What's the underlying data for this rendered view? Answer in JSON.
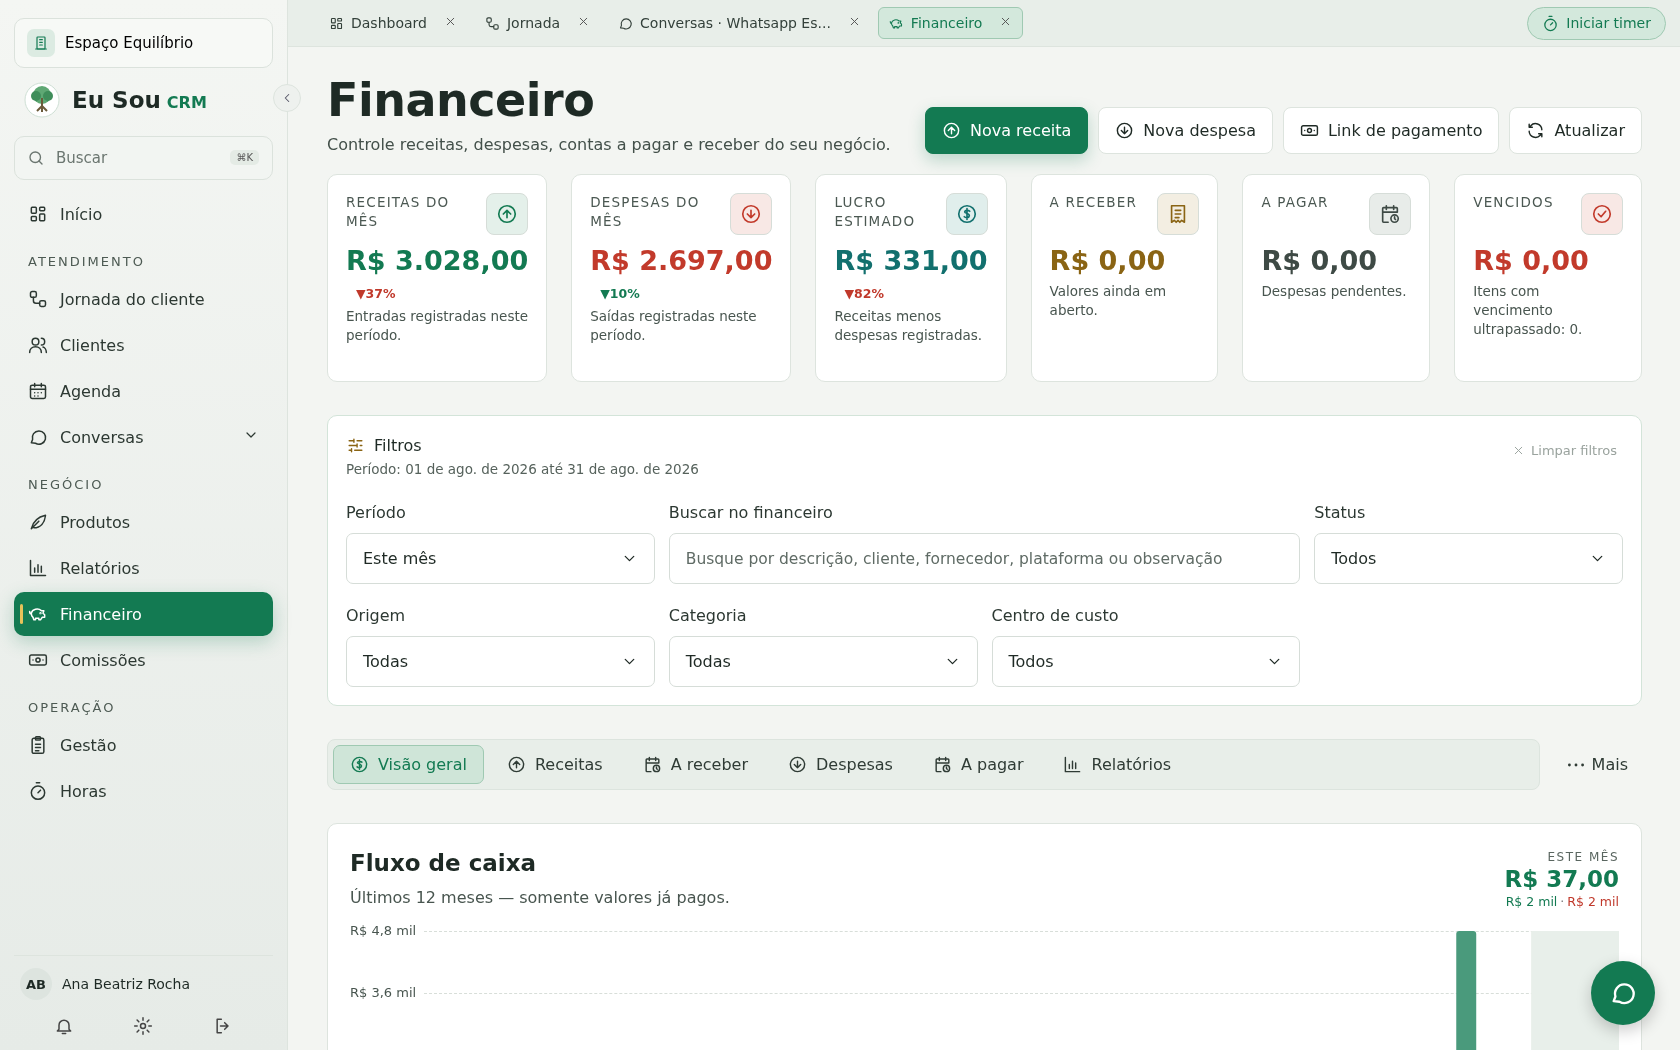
{
  "workspace": {
    "name": "Espaço Equilíbrio"
  },
  "brand": {
    "name": "Eu Sou",
    "suffix": "CRM"
  },
  "search": {
    "placeholder": "Buscar",
    "shortcut": "⌘K"
  },
  "nav": [
    {
      "kind": "item",
      "label": "Início",
      "selected": false
    },
    {
      "kind": "section",
      "label": "ATENDIMENTO"
    },
    {
      "kind": "item",
      "label": "Jornada do cliente",
      "selected": false
    },
    {
      "kind": "item",
      "label": "Clientes",
      "selected": false
    },
    {
      "kind": "item",
      "label": "Agenda",
      "selected": false
    },
    {
      "kind": "group",
      "label": "Conversas",
      "selected": false,
      "expanded": false
    },
    {
      "kind": "section",
      "label": "NEGÓCIO"
    },
    {
      "kind": "item",
      "label": "Produtos",
      "selected": false
    },
    {
      "kind": "item",
      "label": "Relatórios",
      "selected": false
    },
    {
      "kind": "item",
      "label": "Financeiro",
      "selected": true
    },
    {
      "kind": "item",
      "label": "Comissões",
      "selected": false
    },
    {
      "kind": "section",
      "label": "OPERAÇÃO"
    },
    {
      "kind": "item",
      "label": "Gestão",
      "selected": false
    },
    {
      "kind": "item",
      "label": "Horas",
      "selected": false
    }
  ],
  "user": {
    "initials": "AB",
    "name": "Ana Beatriz Rocha"
  },
  "open_tabs": [
    {
      "label": "Dashboard",
      "selected": false
    },
    {
      "label": "Jornada",
      "selected": false
    },
    {
      "label": "Conversas · Whatsapp Es...",
      "selected": false
    },
    {
      "label": "Financeiro",
      "selected": true
    }
  ],
  "timer_button": "Iniciar timer",
  "page": {
    "title": "Financeiro",
    "subtitle": "Controle receitas, despesas, contas a pagar e receber do seu negócio.",
    "actions": [
      {
        "label": "Nova receita",
        "primary": true
      },
      {
        "label": "Nova despesa",
        "primary": false
      },
      {
        "label": "Link de pagamento",
        "primary": false
      },
      {
        "label": "Atualizar",
        "primary": false
      }
    ]
  },
  "cards": [
    {
      "label": "RECEITAS DO MÊS",
      "value": "R$ 3.028,00",
      "color": "#137a52",
      "trend": {
        "text": "▼37%",
        "color": "#c0392b"
      },
      "note": "Entradas registradas neste período."
    },
    {
      "label": "DESPESAS DO MÊS",
      "value": "R$ 2.697,00",
      "color": "#c23a2b",
      "trend": {
        "text": "▼10%",
        "color": "#137a52"
      },
      "note": "Saídas registradas neste período."
    },
    {
      "label": "LUCRO ESTIMADO",
      "value": "R$ 331,00",
      "color": "#12706e",
      "trend": {
        "text": "▼82%",
        "color": "#c0392b"
      },
      "note": "Receitas menos despesas registradas."
    },
    {
      "label": "A RECEBER",
      "value": "R$ 0,00",
      "color": "#8a6414",
      "note": "Valores ainda em aberto."
    },
    {
      "label": "A PAGAR",
      "value": "R$ 0,00",
      "color": "#3e4a45",
      "note": "Despesas pendentes."
    },
    {
      "label": "VENCIDOS",
      "value": "R$ 0,00",
      "color": "#c23a2b",
      "note": "Itens com vencimento ultrapassado: 0."
    }
  ],
  "filters": {
    "title": "Filtros",
    "period_text": "Período: 01 de ago. de 2026 até 31 de ago. de 2026",
    "clear": "Limpar filtros",
    "fields": [
      {
        "kind": "select",
        "label": "Período",
        "value": "Este mês"
      },
      {
        "kind": "search",
        "label": "Buscar no financeiro",
        "placeholder": "Busque por descrição, cliente, fornecedor, plataforma ou observação"
      },
      {
        "kind": "select",
        "label": "Status",
        "value": "Todos"
      },
      {
        "kind": "select",
        "label": "Origem",
        "value": "Todas"
      },
      {
        "kind": "select",
        "label": "Categoria",
        "value": "Todas"
      },
      {
        "kind": "select",
        "label": "Centro de custo",
        "value": "Todos"
      }
    ]
  },
  "section_tabs": [
    {
      "label": "Visão geral",
      "selected": true
    },
    {
      "label": "Receitas",
      "selected": false
    },
    {
      "label": "A receber",
      "selected": false
    },
    {
      "label": "Despesas",
      "selected": false
    },
    {
      "label": "A pagar",
      "selected": false
    },
    {
      "label": "Relatórios",
      "selected": false
    }
  ],
  "more_button": "Mais",
  "cash_flow": {
    "title": "Fluxo de caixa",
    "subtitle": "Últimos 12 meses — somente valores já pagos.",
    "summary_label": "ESTE MÊS",
    "summary_value": "R$ 37,00",
    "income": "R$ 2 mil",
    "separator": "·",
    "expense": "R$ 2 mil",
    "axis_labels": [
      "R$ 4,8 mil",
      "R$ 3,6 mil"
    ]
  }
}
